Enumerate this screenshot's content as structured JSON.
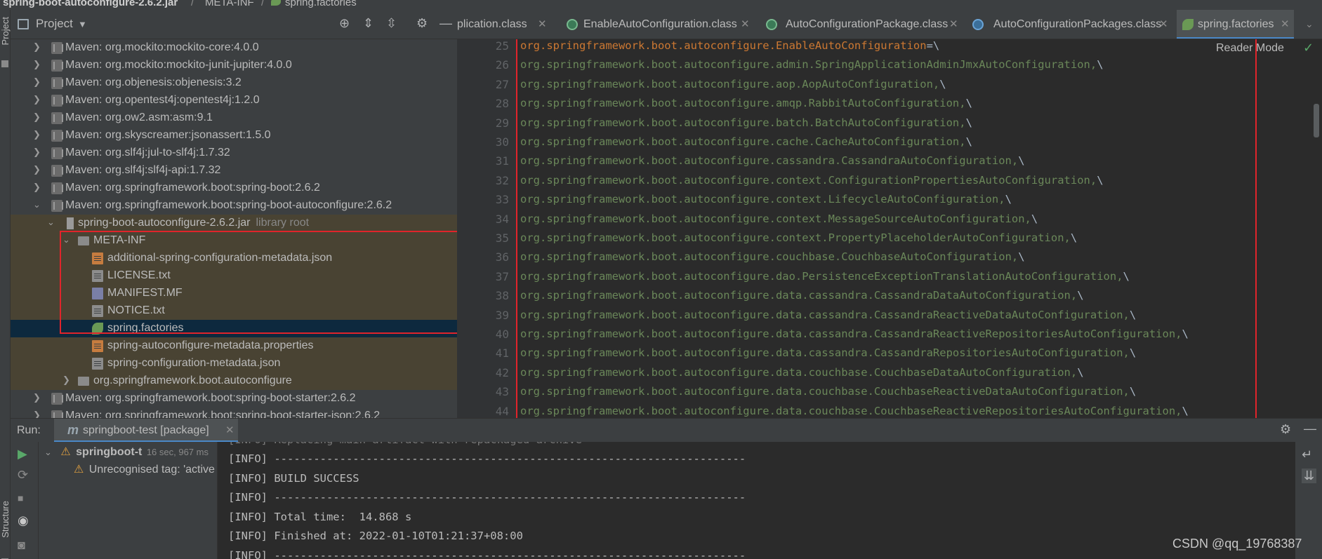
{
  "breadcrumb": {
    "jar": "spring-boot-autoconfigure-2.6.2.jar",
    "folder": "META-INF",
    "file": "spring.factories",
    "separator": "/"
  },
  "left_strip": {
    "project_label": "Project",
    "structure_label": "Structure"
  },
  "project_panel": {
    "title": "Project",
    "dropdown_icon": "chevron-down-icon",
    "header_icons": [
      "target-icon",
      "expand-all-icon",
      "collapse-all-icon",
      "gear-icon",
      "minimize-icon"
    ],
    "rows": [
      {
        "label": "Maven: org.mockito:mockito-core:4.0.0"
      },
      {
        "label": "Maven: org.mockito:mockito-junit-jupiter:4.0.0"
      },
      {
        "label": "Maven: org.objenesis:objenesis:3.2"
      },
      {
        "label": "Maven: org.opentest4j:opentest4j:1.2.0"
      },
      {
        "label": "Maven: org.ow2.asm:asm:9.1"
      },
      {
        "label": "Maven: org.skyscreamer:jsonassert:1.5.0"
      },
      {
        "label": "Maven: org.slf4j:jul-to-slf4j:1.7.32"
      },
      {
        "label": "Maven: org.slf4j:slf4j-api:1.7.32"
      },
      {
        "label": "Maven: org.springframework.boot:spring-boot:2.6.2"
      },
      {
        "label": "Maven: org.springframework.boot:spring-boot-autoconfigure:2.6.2"
      },
      {
        "label": "spring-boot-autoconfigure-2.6.2.jar",
        "sub": "library root"
      },
      {
        "label": "META-INF"
      },
      {
        "label": "additional-spring-configuration-metadata.json"
      },
      {
        "label": "LICENSE.txt"
      },
      {
        "label": "MANIFEST.MF"
      },
      {
        "label": "NOTICE.txt"
      },
      {
        "label": "spring.factories"
      },
      {
        "label": "spring-autoconfigure-metadata.properties"
      },
      {
        "label": "spring-configuration-metadata.json"
      },
      {
        "label": "org.springframework.boot.autoconfigure"
      },
      {
        "label": "Maven: org.springframework.boot:spring-boot-starter:2.6.2"
      },
      {
        "label": "Maven: org.springframework.boot:spring-boot-starter-json:2.6.2"
      }
    ]
  },
  "editor_tabs": [
    {
      "label": "plication.class",
      "close": "✕"
    },
    {
      "label": "EnableAutoConfiguration.class",
      "close": "✕"
    },
    {
      "label": "AutoConfigurationPackage.class",
      "close": "✕"
    },
    {
      "label": "AutoConfigurationPackages.class",
      "close": "✕"
    },
    {
      "label": "spring.factories",
      "close": "✕",
      "active": true
    }
  ],
  "editor": {
    "reader_mode": "Reader Mode",
    "check_icon": "checkmark-icon",
    "key_line": {
      "number": "25",
      "key": "org.springframework.boot.autoconfigure.EnableAutoConfiguration",
      "sep": "=\\"
    },
    "lines": [
      {
        "number": "26",
        "text": "org.springframework.boot.autoconfigure.admin.SpringApplicationAdminJmxAutoConfiguration,",
        "bs": "\\"
      },
      {
        "number": "27",
        "text": "org.springframework.boot.autoconfigure.aop.AopAutoConfiguration,",
        "bs": "\\"
      },
      {
        "number": "28",
        "text": "org.springframework.boot.autoconfigure.amqp.RabbitAutoConfiguration,",
        "bs": "\\"
      },
      {
        "number": "29",
        "text": "org.springframework.boot.autoconfigure.batch.BatchAutoConfiguration,",
        "bs": "\\"
      },
      {
        "number": "30",
        "text": "org.springframework.boot.autoconfigure.cache.CacheAutoConfiguration,",
        "bs": "\\"
      },
      {
        "number": "31",
        "text": "org.springframework.boot.autoconfigure.cassandra.CassandraAutoConfiguration,",
        "bs": "\\"
      },
      {
        "number": "32",
        "text": "org.springframework.boot.autoconfigure.context.ConfigurationPropertiesAutoConfiguration,",
        "bs": "\\"
      },
      {
        "number": "33",
        "text": "org.springframework.boot.autoconfigure.context.LifecycleAutoConfiguration,",
        "bs": "\\"
      },
      {
        "number": "34",
        "text": "org.springframework.boot.autoconfigure.context.MessageSourceAutoConfiguration,",
        "bs": "\\"
      },
      {
        "number": "35",
        "text": "org.springframework.boot.autoconfigure.context.PropertyPlaceholderAutoConfiguration,",
        "bs": "\\"
      },
      {
        "number": "36",
        "text": "org.springframework.boot.autoconfigure.couchbase.CouchbaseAutoConfiguration,",
        "bs": "\\"
      },
      {
        "number": "37",
        "text": "org.springframework.boot.autoconfigure.dao.PersistenceExceptionTranslationAutoConfiguration,",
        "bs": "\\"
      },
      {
        "number": "38",
        "text": "org.springframework.boot.autoconfigure.data.cassandra.CassandraDataAutoConfiguration,",
        "bs": "\\"
      },
      {
        "number": "39",
        "text": "org.springframework.boot.autoconfigure.data.cassandra.CassandraReactiveDataAutoConfiguration,",
        "bs": "\\"
      },
      {
        "number": "40",
        "text": "org.springframework.boot.autoconfigure.data.cassandra.CassandraReactiveRepositoriesAutoConfiguration,",
        "bs": "\\"
      },
      {
        "number": "41",
        "text": "org.springframework.boot.autoconfigure.data.cassandra.CassandraRepositoriesAutoConfiguration,",
        "bs": "\\"
      },
      {
        "number": "42",
        "text": "org.springframework.boot.autoconfigure.data.couchbase.CouchbaseDataAutoConfiguration,",
        "bs": "\\"
      },
      {
        "number": "43",
        "text": "org.springframework.boot.autoconfigure.data.couchbase.CouchbaseReactiveDataAutoConfiguration,",
        "bs": "\\"
      },
      {
        "number": "44",
        "text": "org.springframework.boot.autoconfigure.data.couchbase.CouchbaseReactiveRepositoriesAutoConfiguration,",
        "bs": "\\"
      }
    ]
  },
  "run_panel": {
    "label": "Run:",
    "tab_label": "springboot-test [package]",
    "tab_icon": "maven-icon",
    "tab_close": "✕",
    "settings_icon": "gear-icon",
    "minimize_icon": "minimize-icon",
    "tree": {
      "root_label": "springboot-t",
      "root_time": "16 sec, 967 ms",
      "child_label": "Unrecognised tag: 'active"
    },
    "console_lines": [
      "[INFO] ------------------------------------------------------------------------",
      "[INFO] BUILD SUCCESS",
      "[INFO] ------------------------------------------------------------------------",
      "[INFO] Total time:  14.868 s",
      "[INFO] Finished at: 2022-01-10T01:21:37+08:00",
      "[INFO] ------------------------------------------------------------------------"
    ]
  },
  "watermark": "CSDN @qq_19768387",
  "colors": {
    "accent_red": "#e0242b",
    "key_orange": "#cc7832",
    "value_green": "#6a8759",
    "selection": "#0d293e"
  }
}
